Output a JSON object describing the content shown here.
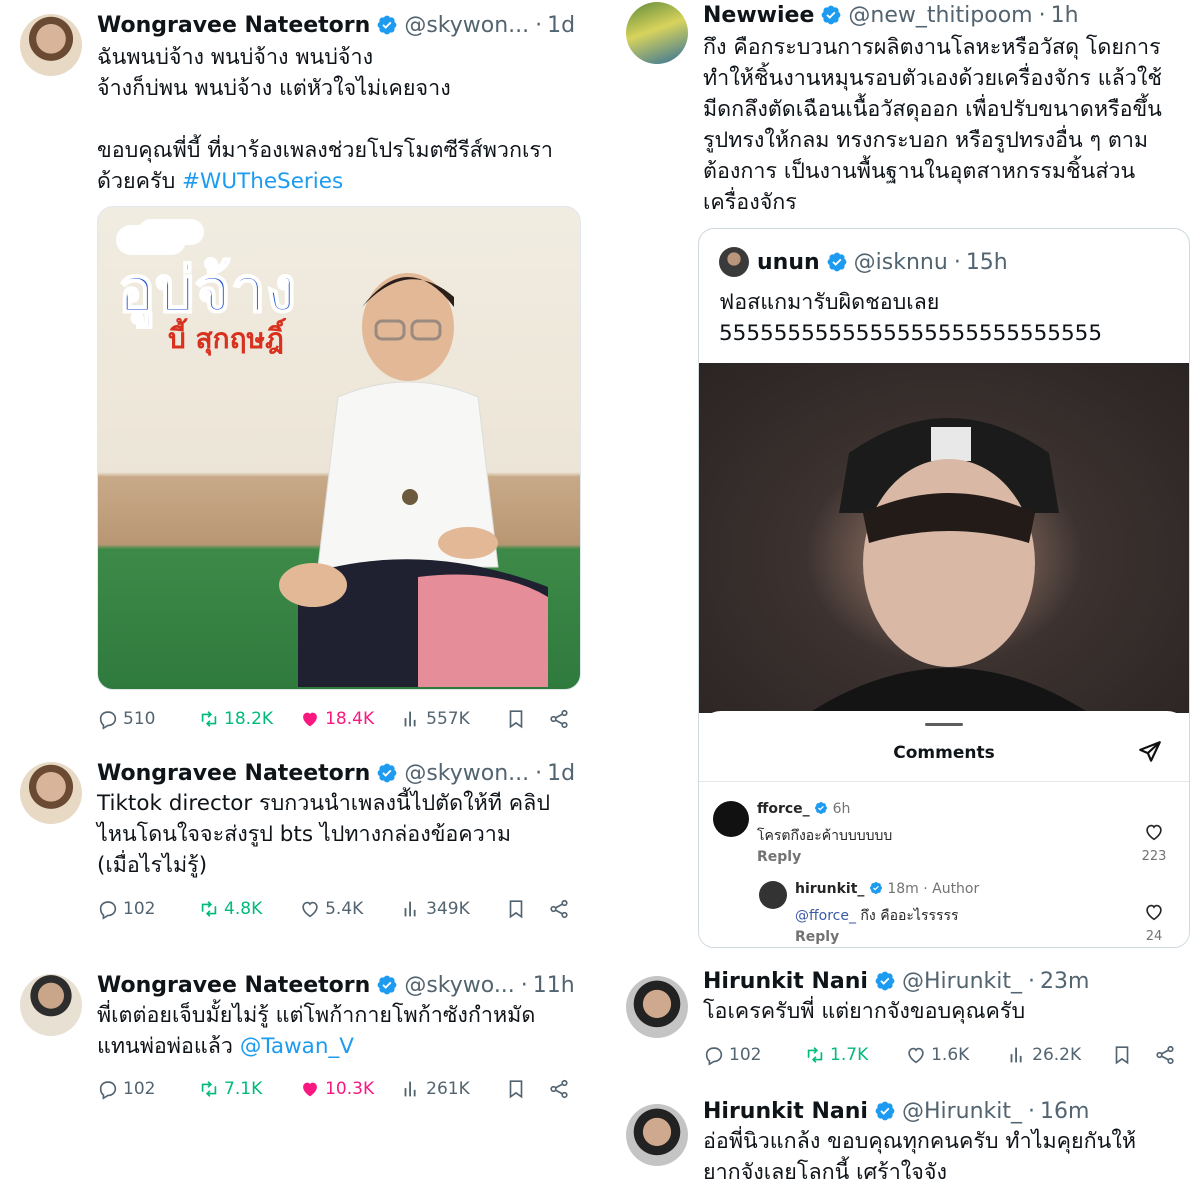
{
  "left": {
    "tweets": [
      {
        "name": "Wongravee Nateetorn",
        "handle": "@skywon...",
        "time": "1d",
        "lines": [
          "ฉันพนบ่จ้าง พนบ่จ้าง พนบ่จ้าง",
          "จ้างก็บ่พน พนบ่จ้าง แต่หัวใจไม่เคยจาง",
          "",
          "ขอบคุณพี่บี้ ที่มาร้องเพลงช่วยโปรโมตซีรีส์พวกเรา"
        ],
        "last_line_prefix": "ด้วยครับ ",
        "hashtag": "#WUTheSeries",
        "poster_title": "อูบ่จ้าง",
        "poster_sub": "บี้ สุกฤษฎิ์",
        "replies": "510",
        "reposts": "18.2K",
        "likes": "18.4K",
        "views": "557K"
      },
      {
        "name": "Wongravee Nateetorn",
        "handle": "@skywon...",
        "time": "1d",
        "lines": [
          "Tiktok director รบกวนนำเพลงนี้ไปตัดให้ที คลิป",
          "ไหนโดนใจจะส่งรูป bts ไปทางกล่องข้อความ",
          "(เมื่อไรไม่รู้)"
        ],
        "replies": "102",
        "reposts": "4.8K",
        "likes": "5.4K",
        "views": "349K"
      },
      {
        "name": "Wongravee Nateetorn",
        "handle": "@skywo...",
        "time": "11h",
        "lines": [
          "พี่เตต่อยเจ็บมั้ยไม่รู้ แต่โพก้ากายโพก้าซังกำหมัด"
        ],
        "last_line_prefix": "แทนพ่อพ่อแล้ว ",
        "mention": "@Tawan_V",
        "replies": "102",
        "reposts": "7.1K",
        "likes": "10.3K",
        "views": "261K"
      }
    ]
  },
  "right": {
    "tweet1": {
      "name": "Newwiee",
      "handle": "@new_thitipoom",
      "time": "1h",
      "lines": [
        "กึง คือกระบวนการผลิตงานโลหะหรือวัสดุ โดยการ",
        "ทำให้ชิ้นงานหมุนรอบตัวเองด้วยเครื่องจักร แล้วใช้",
        "มีดกลึงตัดเฉือนเนื้อวัสดุออก เพื่อปรับขนาดหรือขึ้น",
        "รูปทรงให้กลม ทรงกระบอก หรือรูปทรงอื่น ๆ ตาม",
        "ต้องการ เป็นงานพื้นฐานในอุตสาหกรรมชิ้นส่วน",
        "เครื่องจักร"
      ]
    },
    "quote": {
      "name": "unun",
      "handle": "@isknnu",
      "time": "15h",
      "lines": [
        "ฟอสแกมารับผิดชอบเลย",
        "5555555555555555555555555555"
      ],
      "comments_title": "Comments",
      "comment1": {
        "user": "fforce_",
        "meta": "6h",
        "text": "โครตกึงอะค้าบบบบบบ",
        "reply": "Reply",
        "likes": "223"
      },
      "comment2": {
        "user": "hirunkit_",
        "meta": "18m · Author",
        "mention": "@fforce_",
        "text": " กึง คืออะไรรรรร",
        "reply": "Reply",
        "likes": "24"
      }
    },
    "tweet2": {
      "name": "Hirunkit Nani",
      "handle": "@Hirunkit_",
      "time": "23m",
      "lines": [
        "โอเครครับพี่ แต่ยากจังขอบคุณครับ"
      ],
      "replies": "102",
      "reposts": "1.7K",
      "likes": "1.6K",
      "views": "26.2K"
    },
    "tweet3": {
      "name": "Hirunkit Nani",
      "handle": "@Hirunkit_",
      "time": "16m",
      "lines": [
        "อ่อพี่นิวแกล้ง ขอบคุณทุกคนครับ ทำไมคุยกันให้",
        "ยากจังเลยโลกนี้ เศร้าใจจัง"
      ]
    }
  },
  "colors": {
    "link": "#1d9bf0",
    "repost": "#00ba7c",
    "like": "#f91880",
    "muted": "#536471"
  }
}
